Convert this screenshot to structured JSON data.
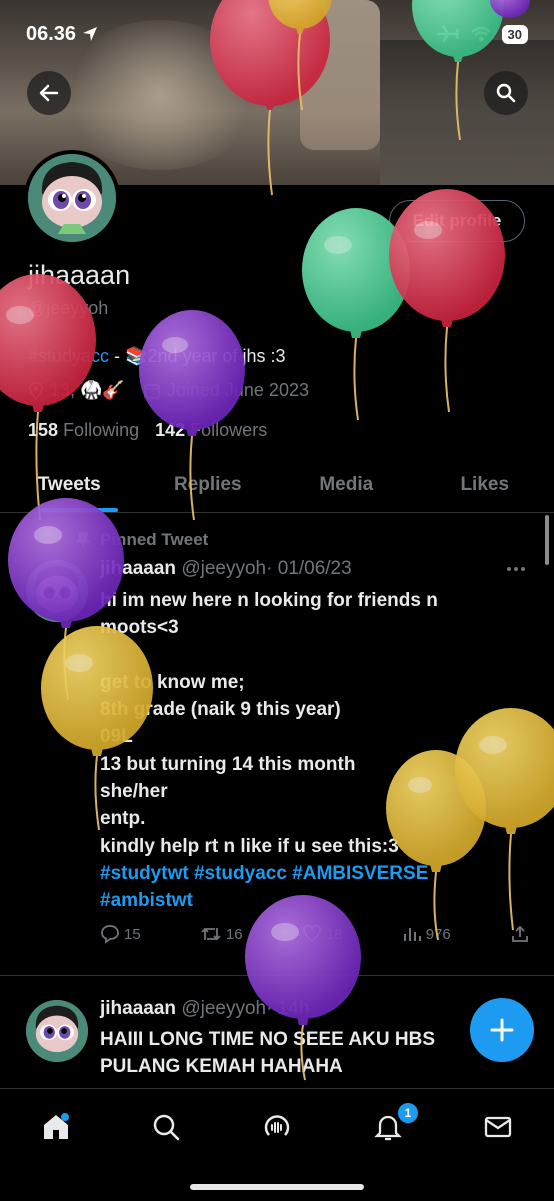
{
  "status_bar": {
    "time": "06.36",
    "battery": "30"
  },
  "profile": {
    "name": "jihaaaan",
    "handle": "@jeeyyoh",
    "edit_label": "Edit profile",
    "bio_tag": "#studyacc",
    "bio_text": " - 📚2nd year of jhs :3",
    "location": "13, 🥋🎸",
    "joined": "Joined June 2023",
    "following_count": "158",
    "following_label": "Following",
    "followers_count": "142",
    "followers_label": "Followers"
  },
  "tabs": [
    "Tweets",
    "Replies",
    "Media",
    "Likes"
  ],
  "pinned_tweet": {
    "pinned_label": "Pinned Tweet",
    "name": "jihaaaan",
    "handle": "@jeeyyoh",
    "date": "· 01/06/23",
    "lines": [
      "hi im new here n looking for friends n",
      "moots<3",
      "",
      "get to know me;",
      "8th grade (naik 9 this year)",
      "09L",
      "13 but turning 14 this month",
      "she/her",
      "entp.",
      "kindly help rt n like if u see this:3"
    ],
    "hashtags_line1": "#studytwt #studyacc #AMBISVERSE",
    "hashtags_line2": "#ambistwt",
    "replies": "15",
    "retweets": "16",
    "likes": "18",
    "views": "976"
  },
  "second_tweet": {
    "name": "jihaaaan",
    "handle": "@jeeyyoh",
    "time": "· 14h",
    "line1": "HAIII LONG TIME NO SEEE AKU HBS",
    "line2": "PULANG KEMAH HAHAHA"
  },
  "nav": {
    "notifications_badge": "1"
  },
  "colors": {
    "accent": "#1d9bf0",
    "background": "#000000",
    "muted": "#71767b"
  },
  "icons": [
    "back-arrow-icon",
    "search-icon",
    "location-icon",
    "calendar-icon",
    "pin-icon",
    "more-icon",
    "reply-icon",
    "retweet-icon",
    "heart-icon",
    "views-icon",
    "share-icon",
    "plus-icon",
    "home-icon",
    "explore-icon",
    "spaces-icon",
    "bell-icon",
    "mail-icon"
  ]
}
